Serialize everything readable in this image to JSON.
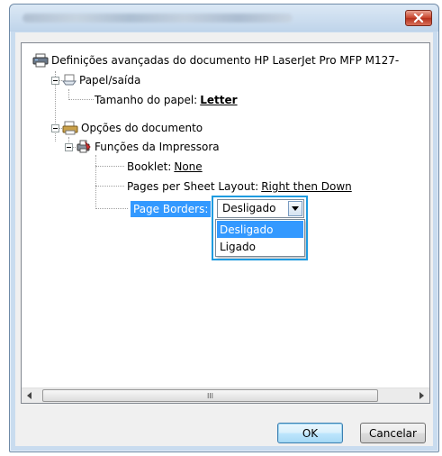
{
  "window": {
    "title": "",
    "close_icon": "close-icon"
  },
  "tree": {
    "root": {
      "label": "Definições avançadas do documento HP LaserJet Pro MFP M127-",
      "icon": "printer-icon"
    },
    "paper_output": {
      "label": "Papel/saída",
      "icon": "paper-tray-icon"
    },
    "paper_size": {
      "label": "Tamanho do papel:",
      "value": "Letter"
    },
    "document_options": {
      "label": "Opções do documento",
      "icon": "document-options-icon"
    },
    "printer_features": {
      "label": "Funções da Impressora",
      "icon": "printer-features-icon"
    },
    "booklet": {
      "label": "Booklet:",
      "value": "None"
    },
    "pages_per_sheet": {
      "label": "Pages per Sheet Layout:",
      "value": "Right then Down"
    },
    "page_borders": {
      "label": "Page Borders:",
      "value": "Desligado"
    }
  },
  "dropdown": {
    "options": [
      "Desligado",
      "Ligado"
    ],
    "selected": "Desligado"
  },
  "scrollbar": {
    "thumb_grip": "III"
  },
  "buttons": {
    "ok": "OK",
    "cancel": "Cancelar"
  },
  "colors": {
    "selection": "#3399ff",
    "highlight_box": "#1e9be0",
    "close_button": "#c7432b"
  }
}
